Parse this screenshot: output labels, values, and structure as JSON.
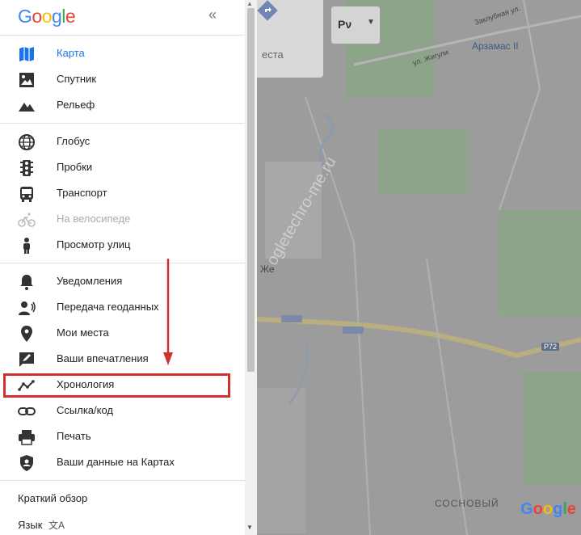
{
  "sidebar": {
    "logo": "Google",
    "collapse_icon": "double-chevron-left-icon",
    "group1": [
      {
        "label": "Карта",
        "icon": "map-icon",
        "active": true
      },
      {
        "label": "Спутник",
        "icon": "satellite-icon"
      },
      {
        "label": "Рельеф",
        "icon": "terrain-icon"
      }
    ],
    "group2": [
      {
        "label": "Глобус",
        "icon": "globe-icon"
      },
      {
        "label": "Пробки",
        "icon": "traffic-light-icon"
      },
      {
        "label": "Транспорт",
        "icon": "bus-icon"
      },
      {
        "label": "На велосипеде",
        "icon": "bicycle-icon",
        "disabled": true
      },
      {
        "label": "Просмотр улиц",
        "icon": "pegman-icon"
      }
    ],
    "group3": [
      {
        "label": "Уведомления",
        "icon": "bell-icon"
      },
      {
        "label": "Передача геоданных",
        "icon": "location-share-icon"
      },
      {
        "label": "Мои места",
        "icon": "place-pin-icon"
      },
      {
        "label": "Ваши впечатления",
        "icon": "review-icon"
      },
      {
        "label": "Хронология",
        "icon": "timeline-icon"
      },
      {
        "label": "Ссылка/код",
        "icon": "link-icon"
      },
      {
        "label": "Печать",
        "icon": "printer-icon"
      },
      {
        "label": "Ваши данные на Картах",
        "icon": "account-shield-icon"
      }
    ],
    "bottom": {
      "overview": "Краткий обзор",
      "language": "Язык",
      "language_icon": "translate-icon"
    }
  },
  "map": {
    "search_placeholder_fragment": "еста",
    "lang_button": "Рν",
    "places": {
      "arzamas": "Арзамас II",
      "zhiguli": "ул. Жигули",
      "zakrubnaya": "Заклубная ул.",
      "p72": "Р72",
      "sosnovy": "СОСНОВЫЙ",
      "zhe": "Же",
      "watermark": "ogletechro-me.ru"
    },
    "logo": "Google"
  },
  "colors": {
    "accent": "#1a73e8",
    "highlight": "#d32f2f",
    "map_gray": "#9a9a9a"
  }
}
